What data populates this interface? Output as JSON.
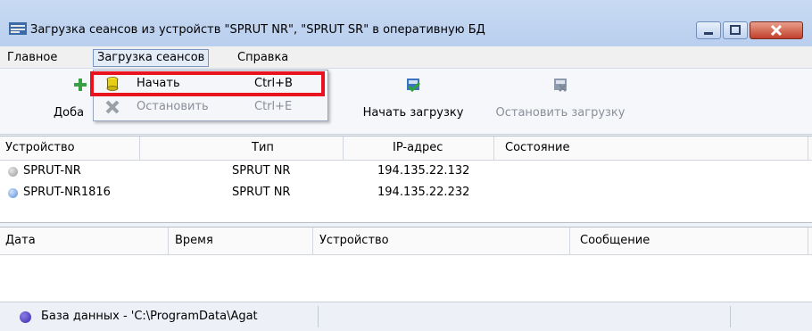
{
  "window": {
    "title": "Загрузка сеансов из устройств \"SPRUT NR\", \"SPRUT SR\" в оперативную БД"
  },
  "menubar": {
    "items": [
      "Главное",
      "Загрузка сеансов",
      "Справка"
    ]
  },
  "dropdown": {
    "items": [
      {
        "label": "Начать",
        "shortcut": "Ctrl+B",
        "enabled": true
      },
      {
        "label": "Остановить",
        "shortcut": "Ctrl+E",
        "enabled": false
      }
    ]
  },
  "toolbar": {
    "add_label_partial": "Доба",
    "start_load_label": "Начать загрузку",
    "stop_load_label": "Остановить загрузку"
  },
  "devices_table": {
    "columns": [
      "Устройство",
      "Тип",
      "IP-адрес",
      "Состояние"
    ],
    "rows": [
      {
        "device": "SPRUT-NR",
        "type": "SPRUT NR",
        "ip": "194.135.22.132",
        "state": ""
      },
      {
        "device": "SPRUT-NR1816",
        "type": "SPRUT NR",
        "ip": "194.135.22.232",
        "state": ""
      }
    ]
  },
  "log_table": {
    "columns": [
      "Дата",
      "Время",
      "Устройство",
      "Сообщение"
    ]
  },
  "statusbar": {
    "text": "База данных - 'C:\\ProgramData\\Agat"
  },
  "colors": {
    "highlight": "#e8131f",
    "status_dot": "#5a48c8"
  }
}
